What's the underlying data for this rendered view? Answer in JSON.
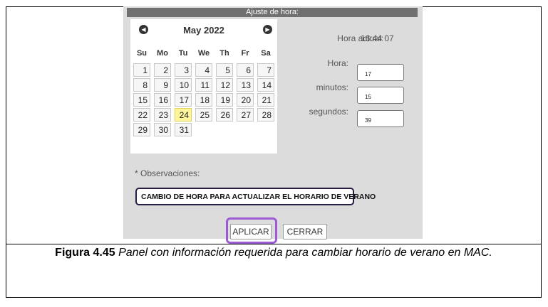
{
  "panel": {
    "title": "Ajuste de hora:",
    "calendar": {
      "month_label": "May 2022",
      "prev_symbol": "◀",
      "next_symbol": "▶",
      "weekdays": [
        "Su",
        "Mo",
        "Tu",
        "We",
        "Th",
        "Fr",
        "Sa"
      ],
      "days": [
        "1",
        "2",
        "3",
        "4",
        "5",
        "6",
        "7",
        "8",
        "9",
        "10",
        "11",
        "12",
        "13",
        "14",
        "15",
        "16",
        "17",
        "18",
        "19",
        "20",
        "21",
        "22",
        "23",
        "24",
        "25",
        "26",
        "27",
        "28",
        "29",
        "30",
        "31"
      ],
      "selected_day": "24"
    },
    "current_time_label": "Hora actual:",
    "current_time_value": "16:44 07",
    "hour_label": "Hora:",
    "hour_value": "17",
    "minutes_label": "minutos:",
    "minutes_value": "15",
    "seconds_label": "segundos:",
    "seconds_value": "39",
    "observations_label": "* Observaciones:",
    "observations_value": "CAMBIO DE HORA PARA ACTUALIZAR EL HORARIO DE VERANO",
    "apply_label": "APLICAR",
    "close_label": "CERRAR",
    "highlight_color": "#9d5bd3",
    "today_color": "#fff59a"
  },
  "caption": {
    "figure_label": "Figura 4.45",
    "text": " Panel con información requerida para cambiar horario de verano en MAC."
  }
}
